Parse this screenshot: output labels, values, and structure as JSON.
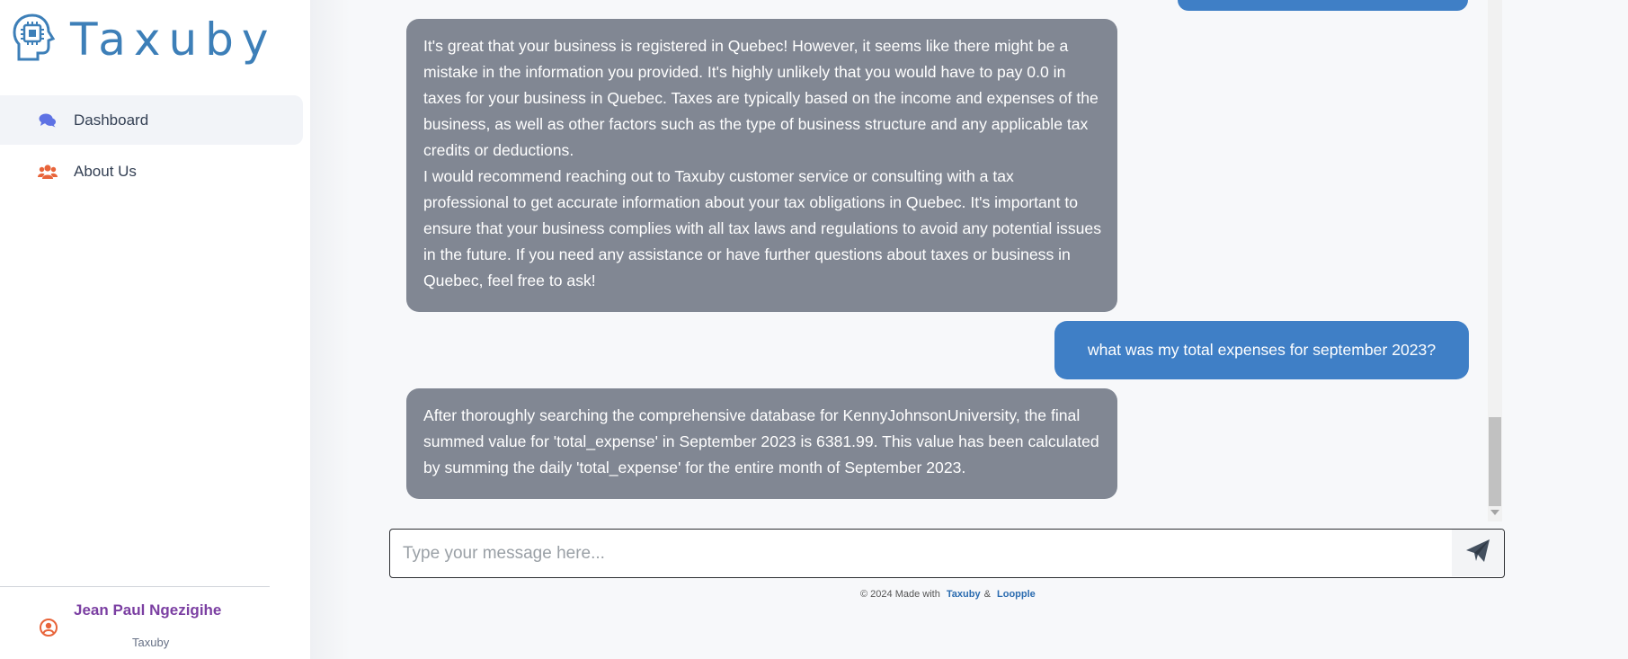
{
  "brand": {
    "name": "Taxuby"
  },
  "sidebar": {
    "items": [
      {
        "label": "Dashboard",
        "icon": "comments-icon",
        "active": true
      },
      {
        "label": "About Us",
        "icon": "users-icon",
        "active": false
      }
    ],
    "user": {
      "name": "Jean Paul Ngezigihe",
      "org": "Taxuby"
    }
  },
  "chat": {
    "messages": [
      {
        "role": "assistant",
        "paragraphs": [
          "It's great that your business is registered in Quebec! However, it seems like there might be a mistake in the information you provided. It's highly unlikely that you would have to pay 0.0 in taxes for your business in Quebec. Taxes are typically based on the income and expenses of the business, as well as other factors such as the type of business structure and any applicable tax credits or deductions.",
          "I would recommend reaching out to Taxuby customer service or consulting with a tax professional to get accurate information about your tax obligations in Quebec. It's important to ensure that your business complies with all tax laws and regulations to avoid any potential issues in the future. If you need any assistance or have further questions about taxes or business in Quebec, feel free to ask!"
        ]
      },
      {
        "role": "user",
        "text": "what was my total expenses for september 2023?"
      },
      {
        "role": "assistant",
        "paragraphs": [
          "After thoroughly searching the comprehensive database for KennyJohnsonUniversity, the final summed value for 'total_expense' in September 2023 is 6381.99. This value has been calculated by summing the daily 'total_expense' for the entire month of September 2023."
        ]
      }
    ]
  },
  "composer": {
    "placeholder": "Type your message here...",
    "value": ""
  },
  "footer": {
    "prefix": "© 2024 Made with",
    "link1": "Taxuby",
    "amp": "&",
    "link2": "Loopple"
  },
  "colors": {
    "brand": "#3d7fb8",
    "user_bubble": "#3f7fc6",
    "bot_bubble": "#818793",
    "user_name": "#7b3fa2",
    "accent_orange": "#e8643a"
  }
}
